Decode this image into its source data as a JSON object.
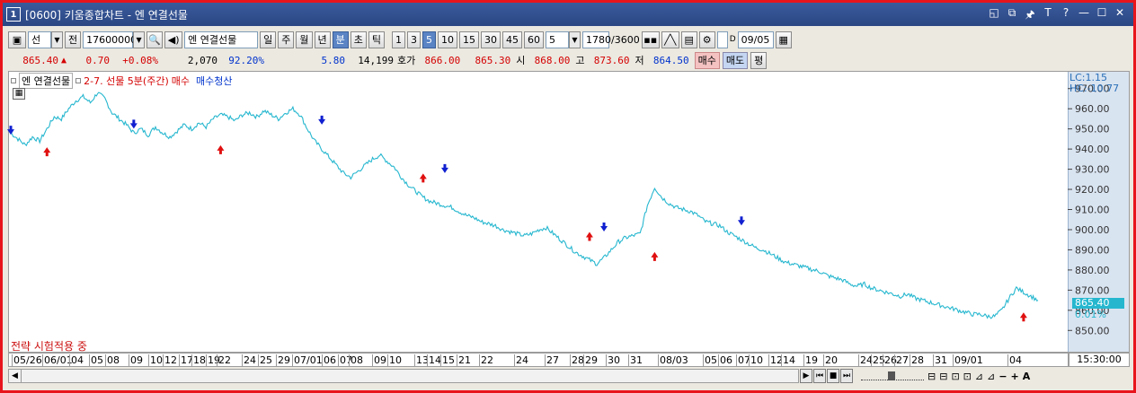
{
  "window": {
    "number_badge": "1",
    "title": "[0600] 키움종합차트 - 엔 연결선물",
    "controls": [
      "◱",
      "⧉",
      "🖈",
      "T",
      "?",
      "—",
      "☐",
      "✕"
    ]
  },
  "toolbar": {
    "market_select": "선",
    "prev_label": "전",
    "code_value": "17600000",
    "product_name": "엔 연결선물",
    "period_buttons": [
      "일",
      "주",
      "월",
      "년",
      "분",
      "초",
      "틱"
    ],
    "active_period": "분",
    "interval_buttons": [
      "1",
      "3",
      "5",
      "10",
      "15",
      "30",
      "45",
      "60"
    ],
    "active_interval": "5",
    "interval_value": "5",
    "count_value": "1780",
    "count_max": "/3600",
    "date_value": "09/05",
    "date_checkbox_label": "D"
  },
  "quote": {
    "price": "865.40",
    "change": "0.70",
    "change_pct": "+0.08%",
    "volume": "2,070",
    "volume_ratio": "92.20%",
    "v1": "5.80",
    "v2": "14,199",
    "bid_ask_label": "호가",
    "ask": "866.00",
    "bid": "865.30",
    "open_label": "시",
    "open": "868.00",
    "high_label": "고",
    "high": "873.60",
    "low_label": "저",
    "low": "864.50",
    "buy_label": "매수",
    "sell_label": "매도",
    "eval_label": "평"
  },
  "chart_legend": {
    "item1": "엔 연결선물",
    "strategy": "2-7. 선물 5분(주간)",
    "buy": "매수",
    "sell_exit": "매수청산",
    "lc": "LC:1.15",
    "hc": "HC:-10.77",
    "current_price": "865.40",
    "current_pct": "0.01%",
    "status_text": "전략 시험적용 중",
    "time_label": "15:30:00"
  },
  "chart_data": {
    "type": "line",
    "ylim": [
      843,
      973
    ],
    "yticks": [
      "970.00",
      "960.00",
      "950.00",
      "940.00",
      "930.00",
      "920.00",
      "910.00",
      "900.00",
      "890.00",
      "880.00",
      "870.00",
      "860.00",
      "850.00"
    ],
    "x_labels": [
      "05/26",
      "06/01",
      "04",
      "05",
      "08",
      "09",
      "10",
      "12",
      "17",
      "18",
      "19",
      "22",
      "24",
      "25",
      "29",
      "07/01",
      "06",
      "07",
      "08",
      "09",
      "10",
      "13",
      "14",
      "15",
      "21",
      "22",
      "24",
      "27",
      "28",
      "29",
      "30",
      "31",
      "08/03",
      "05",
      "06",
      "07",
      "10",
      "12",
      "14",
      "19",
      "20",
      "24",
      "25",
      "26",
      "27",
      "28",
      "31",
      "09/01",
      "04"
    ],
    "x_label_positions": [
      12,
      46,
      76,
      98,
      116,
      142,
      164,
      180,
      198,
      212,
      228,
      240,
      268,
      286,
      306,
      324,
      357,
      375,
      387,
      413,
      430,
      460,
      474,
      489,
      507,
      532,
      571,
      605,
      633,
      648,
      673,
      698,
      731,
      781,
      798,
      818,
      832,
      854,
      868,
      893,
      915,
      954,
      968,
      981,
      994,
      1011,
      1037,
      1059,
      1120
    ],
    "series": [
      {
        "values": [
          948,
          945,
          942,
          946,
          944,
          950,
          956,
          955,
          960,
          964,
          966,
          963,
          968,
          965,
          958,
          955,
          952,
          948,
          950,
          947,
          951,
          948,
          946,
          949,
          952,
          950,
          953,
          951,
          955,
          957,
          956,
          954,
          957,
          958,
          956,
          959,
          957,
          955,
          958,
          960,
          957,
          950,
          944,
          940,
          936,
          932,
          928,
          926,
          929,
          932,
          935,
          937,
          934,
          931,
          926,
          922,
          919,
          916,
          914,
          913,
          912,
          911,
          909,
          907,
          906,
          904,
          903,
          902,
          900,
          899,
          898,
          897,
          898,
          900,
          901,
          898,
          895,
          892,
          889,
          887,
          885,
          883,
          886,
          890,
          894,
          896,
          897,
          898,
          912,
          921,
          916,
          913,
          911,
          910,
          909,
          907,
          904,
          903,
          902,
          899,
          897,
          895,
          893,
          891,
          890,
          888,
          886,
          884,
          883,
          882,
          881,
          880,
          879,
          877,
          876,
          875,
          873,
          872,
          873,
          871,
          870,
          869,
          868,
          867,
          868,
          866,
          865,
          864,
          863,
          862,
          861,
          860,
          859,
          858,
          858,
          857,
          857,
          860,
          866,
          871,
          869,
          867,
          865
        ]
      }
    ],
    "signals": [
      {
        "type": "sell",
        "i": 0,
        "y": 948
      },
      {
        "type": "buy",
        "i": 8,
        "y": 940
      },
      {
        "type": "sell",
        "i": 28,
        "y": 951
      },
      {
        "type": "buy",
        "i": 49,
        "y": 941
      },
      {
        "type": "sell",
        "i": 72,
        "y": 953
      },
      {
        "type": "buy",
        "i": 95,
        "y": 927
      },
      {
        "type": "sell",
        "i": 100,
        "y": 929
      },
      {
        "type": "buy",
        "i": 134,
        "y": 898
      },
      {
        "type": "sell",
        "i": 137,
        "y": 900
      },
      {
        "type": "buy",
        "i": 150,
        "y": 888
      },
      {
        "type": "sell",
        "i": 170,
        "y": 903
      },
      {
        "type": "buy",
        "i": 234,
        "y": 858
      }
    ]
  },
  "bottom": {
    "scroll_buttons": [
      "▶",
      "⏮",
      "■",
      "⏭"
    ],
    "tools": [
      "⊟",
      "⊟",
      "⊡",
      "⊡",
      "⊿",
      "⊿",
      "−",
      "+",
      "A"
    ]
  }
}
